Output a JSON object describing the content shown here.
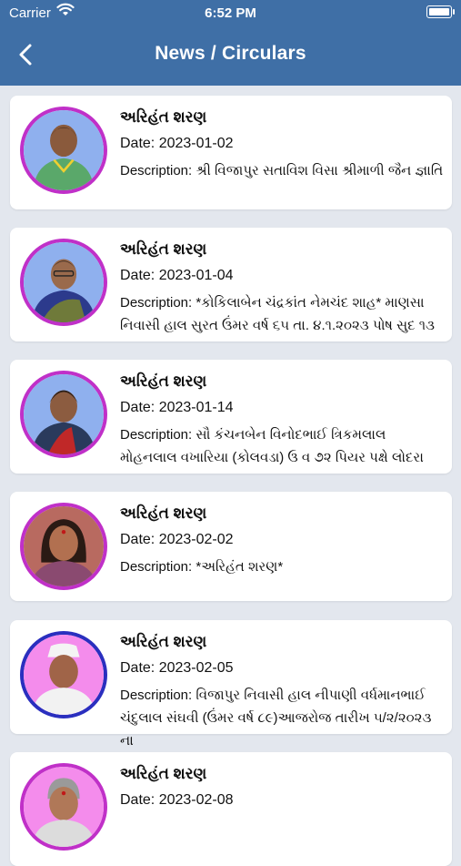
{
  "status_bar": {
    "carrier": "Carrier",
    "time": "6:52 PM"
  },
  "header": {
    "title": "News / Circulars"
  },
  "items": [
    {
      "name": "અરિહંત શરણ",
      "date": "Date: 2023-01-02",
      "description": "Description: શ્રી વિજાપુર સતાવિશ વિસા શ્રીમાળી જૈન જ્ઞાતિ",
      "avatar_bg": "#8fb0ee",
      "ring": "#c030c8"
    },
    {
      "name": "અરિહંત શરણ",
      "date": "Date: 2023-01-04",
      "description": "Description: *કોકિલાબેન ચંદ્રકાંત નેમચંદ શાહ* માણસા નિવાસી હાલ સુરત ઉંમર વર્ષ ૬૫ તા. ૪.૧.૨૦૨૩ પોષ સુદ ૧૩",
      "avatar_bg": "#8fb0ee",
      "ring": "#c030c8"
    },
    {
      "name": "અરિહંત શરણ",
      "date": "Date: 2023-01-14",
      "description": "Description: સૌ કંચનબેન વિનોદભાઈ ત્રિકમલાલ મોહનલાલ વખારિયા (કોલવડા) ઉ વ ૭૨  પિયર પક્ષે લોદરા",
      "avatar_bg": "#8fb0ee",
      "ring": "#c030c8"
    },
    {
      "name": "અરિહંત શરણ",
      "date": "Date: 2023-02-02",
      "description": "Description: *અરિહંત શરણ*",
      "avatar_bg": "#c06f6a",
      "ring": "#c030c8"
    },
    {
      "name": "અરિહંત શરણ",
      "date": "Date: 2023-02-05",
      "description": "Description: વિજાપુર નિવાસી હાલ નીપાણી વર્ધમાનભાઈ ચંદુલાલ સંઘવી (ઉંમર વર્ષ ૮૯)આજરોજ તારીખ ૫/૨/૨૦૨૩ ના",
      "avatar_bg": "#f48cec",
      "ring": "#2a2fbf"
    },
    {
      "name": "અરિહંત શરણ",
      "date": "Date: 2023-02-08",
      "description": "",
      "avatar_bg": "#f48cec",
      "ring": "#c030c8"
    }
  ]
}
